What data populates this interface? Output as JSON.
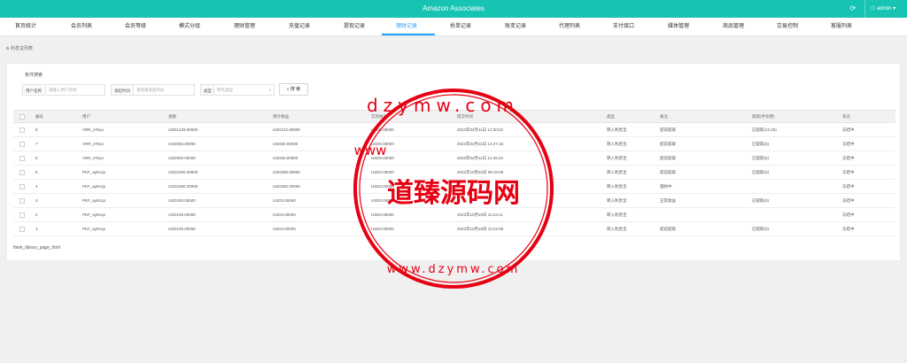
{
  "app": {
    "title": "Amazon Associates"
  },
  "header": {
    "refresh_icon": "⟳",
    "user_icon": "⚇",
    "user_name": "admin",
    "caret": "▾"
  },
  "nav": {
    "tabs": [
      {
        "label": "首页统计"
      },
      {
        "label": "会员列表"
      },
      {
        "label": "会员等级"
      },
      {
        "label": "模式分组"
      },
      {
        "label": "理财管理"
      },
      {
        "label": "充值记录"
      },
      {
        "label": "提现记录"
      },
      {
        "label": "理财记录"
      },
      {
        "label": "抢单记录"
      },
      {
        "label": "账变记录"
      },
      {
        "label": "代理列表"
      },
      {
        "label": "支付接口"
      },
      {
        "label": "媒体管理"
      },
      {
        "label": "商品管理"
      },
      {
        "label": "交易控制"
      },
      {
        "label": "客服列表"
      }
    ],
    "active_index": 7
  },
  "breadcrumb": "利息宝列表",
  "filter": {
    "title": "条件搜索",
    "user_label": "用户名称",
    "user_placeholder": "请输入用户名称",
    "date_label": "发起时间",
    "date_placeholder": "请选择发起时间",
    "type_label": "类型",
    "type_value": "所有类型",
    "search_icon": "⌕",
    "search_label": "搜 索"
  },
  "table": {
    "columns": [
      "编号",
      "用户",
      "金额",
      "预计收益",
      "实际收益",
      "提交时间",
      "类型",
      "备注",
      "提取(手续费)",
      "状态"
    ],
    "rows": [
      {
        "id": "8",
        "user": "VRR_eTeyo",
        "amount": "USD1229.00000",
        "expected": "USD122.90000",
        "actual": "USD0.00000",
        "time": "2023年04月11日 12:30:02",
        "type": "转入利息宝",
        "note": "提前提取",
        "withdraw": "已提取(12.29)",
        "status": "冻结中"
      },
      {
        "id": "7",
        "user": "VRR_eTeyo",
        "amount": "USD500.00000",
        "expected": "USD50.00000",
        "actual": "USD0.00000",
        "time": "2023年04月11日 12:27:16",
        "type": "转入利息宝",
        "note": "提前提取",
        "withdraw": "已提取(5)",
        "status": "冻结中"
      },
      {
        "id": "6",
        "user": "VRR_eTeyo",
        "amount": "USD500.00000",
        "expected": "USD50.00000",
        "actual": "USD0.00000",
        "time": "2023年04月11日 12:26:22",
        "type": "转入利息宝",
        "note": "提前提取",
        "withdraw": "已提取(5)",
        "status": "冻结中"
      },
      {
        "id": "5",
        "user": "PKF_ay5n1p",
        "amount": "USD1000.00000",
        "expected": "USD280.00000",
        "actual": "USD0.00000",
        "time": "2022年10月20日 09:10:59",
        "type": "转入利息宝",
        "note": "提前提取",
        "withdraw": "已提取(0)",
        "status": "冻结中"
      },
      {
        "id": "4",
        "user": "PKF_ay5n1p",
        "amount": "USD1000.00000",
        "expected": "USD280.00000",
        "actual": "USD0.00000",
        "time": "",
        "type": "转入利息宝",
        "note": "理财中",
        "withdraw": "",
        "status": "冻结中"
      },
      {
        "id": "3",
        "user": "PKF_ay5n1p",
        "amount": "USD100.00000",
        "expected": "USD3.00000",
        "actual": "USD0.00000",
        "time": "",
        "type": "转入利息宝",
        "note": "正常收益",
        "withdraw": "已提取(0)",
        "status": "冻结中"
      },
      {
        "id": "2",
        "user": "PKF_ay5n1p",
        "amount": "USD100.00000",
        "expected": "USD3.00000",
        "actual": "USD0.00000",
        "time": "2022年10月19日 12:24:11",
        "type": "转入利息宝",
        "note": "",
        "withdraw": "",
        "status": "冻结中"
      },
      {
        "id": "1",
        "user": "PKF_ay5n1p",
        "amount": "USD100.00000",
        "expected": "USD3.00000",
        "actual": "USD0.00000",
        "time": "2022年10月19日 12:22:58",
        "type": "转入利息宝",
        "note": "提前提取",
        "withdraw": "已提取(0)",
        "status": "冻结中"
      }
    ]
  },
  "pager": {
    "text": "think_library_page_html"
  },
  "watermark": {
    "center_text": "道臻源码网",
    "top_text": "dzymw.com",
    "side_text": "www",
    "bottom_text": "www.dzymw.com",
    "color": "#e60012"
  },
  "colors": {
    "topbar": "#17c3b2",
    "accent": "#1e9fff"
  }
}
